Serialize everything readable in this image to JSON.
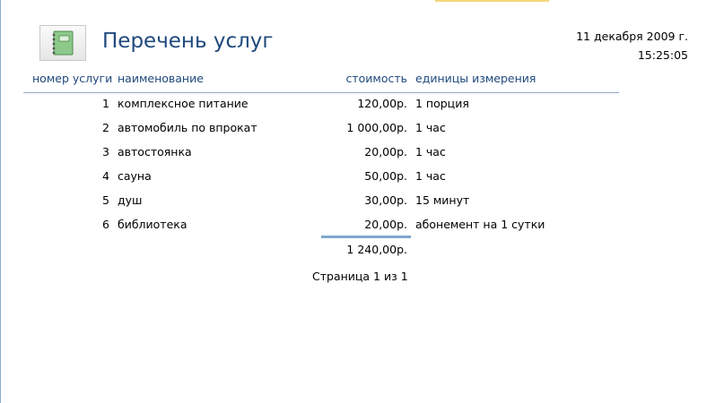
{
  "report": {
    "title": "Перечень услуг",
    "date": "11 декабря 2009 г.",
    "time": "15:25:05"
  },
  "columns": {
    "number": "номер услуги",
    "name": "наименование",
    "cost": "стоимость",
    "unit": "единицы измерения"
  },
  "rows": [
    {
      "number": "1",
      "name": "комплексное питание",
      "cost": "120,00р.",
      "unit": "1 порция"
    },
    {
      "number": "2",
      "name": "автомобиль по впрокат",
      "cost": "1 000,00р.",
      "unit": "1 час"
    },
    {
      "number": "3",
      "name": "автостоянка",
      "cost": "20,00р.",
      "unit": "1 час"
    },
    {
      "number": "4",
      "name": "сауна",
      "cost": "50,00р.",
      "unit": "1 час"
    },
    {
      "number": "5",
      "name": "душ",
      "cost": "30,00р.",
      "unit": "15 минут"
    },
    {
      "number": "6",
      "name": "библиотека",
      "cost": "20,00р.",
      "unit": "абонемент на 1 сутки"
    }
  ],
  "total": "1 240,00р.",
  "footer": "Страница 1 из 1",
  "colors": {
    "title": "#1f497d",
    "rule": "#8fa9c9",
    "total_rule": "#7fa6cf"
  },
  "icons": {
    "report": "notebook-icon"
  }
}
